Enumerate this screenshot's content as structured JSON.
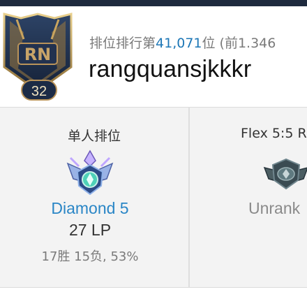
{
  "profile": {
    "level": "32",
    "rank_prefix": "排位排行第",
    "rank_number": "41,071",
    "rank_suffix": "位 (前1.346",
    "summoner_name": "rangquansjkkkr"
  },
  "ranked": {
    "solo": {
      "title": "单人排位",
      "tier": "Diamond 5",
      "lp": "27 LP",
      "record": "17胜 15负, 53%"
    },
    "flex": {
      "title": "Flex 5:5 R",
      "tier": "Unrank"
    }
  },
  "colors": {
    "accent_blue": "#2a86c6",
    "rank_number_blue": "#1d77b6",
    "unranked_gray": "#8a8a8a",
    "header_bar": "#1e2a3e"
  },
  "icons": [
    "profile-emblem-icon",
    "diamond-tier-icon",
    "unranked-tier-icon"
  ]
}
